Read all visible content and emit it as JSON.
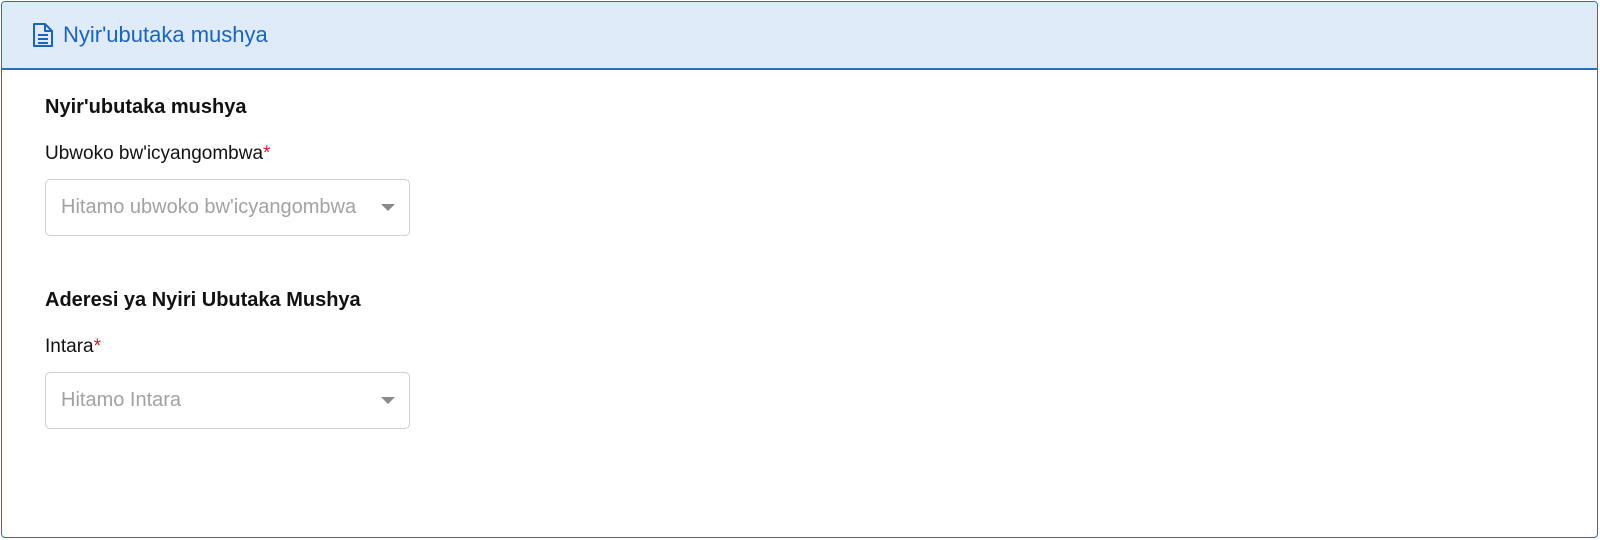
{
  "header": {
    "icon": "document-icon",
    "title": "Nyir'ubutaka mushya",
    "accent_color": "#1a64c0",
    "background_color": "#dfebf8"
  },
  "section1": {
    "title": "Nyir'ubutaka mushya",
    "field": {
      "label": "Ubwoko bw'icyangombwa",
      "required_mark": "*",
      "placeholder": "Hitamo ubwoko bw'icyangombwa"
    }
  },
  "section2": {
    "title": "Aderesi ya Nyiri Ubutaka Mushya",
    "field": {
      "label": "Intara",
      "required_mark": "*",
      "placeholder": "Hitamo Intara"
    }
  },
  "colors": {
    "required": "#e0142b",
    "border": "#2f6db8",
    "placeholder": "#a2a2a2"
  }
}
